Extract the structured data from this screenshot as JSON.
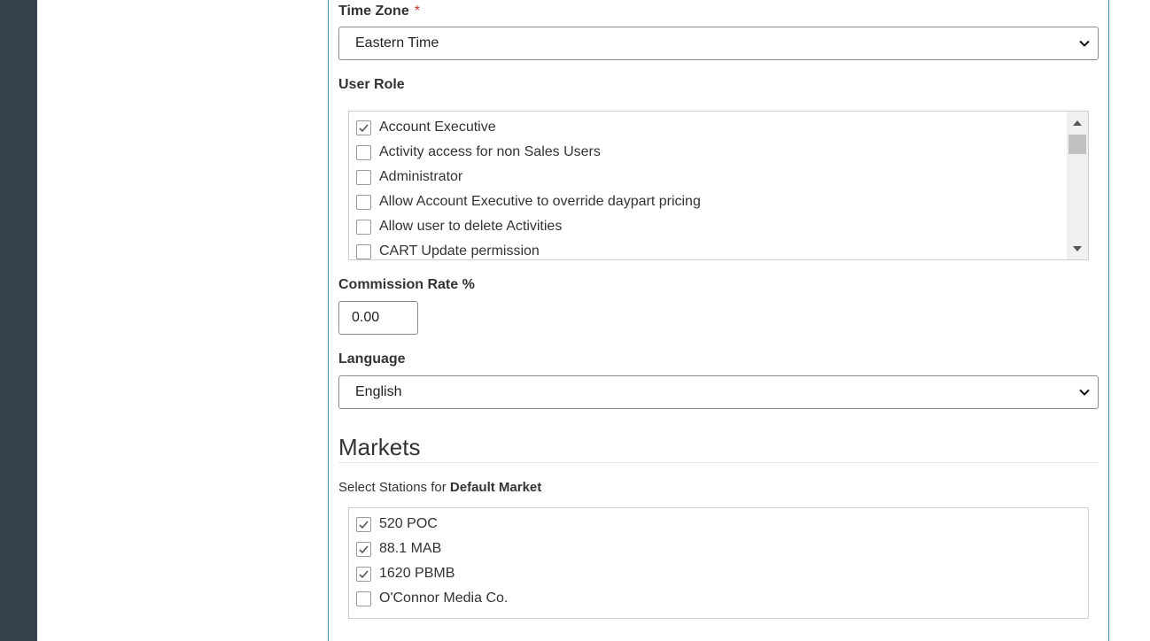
{
  "time_zone": {
    "label": "Time Zone",
    "required_marker": "*",
    "selected": "Eastern Time"
  },
  "user_role": {
    "label": "User Role",
    "items": [
      {
        "label": "Account Executive",
        "checked": true
      },
      {
        "label": "Activity access for non Sales Users",
        "checked": false
      },
      {
        "label": "Administrator",
        "checked": false
      },
      {
        "label": "Allow Account Executive to override daypart pricing",
        "checked": false
      },
      {
        "label": "Allow user to delete Activities",
        "checked": false
      },
      {
        "label": "CART Update permission",
        "checked": false
      }
    ]
  },
  "commission": {
    "label": "Commission Rate %",
    "value": "0.00"
  },
  "language": {
    "label": "Language",
    "selected": "English"
  },
  "markets": {
    "title": "Markets",
    "subtext_prefix": "Select Stations for",
    "subtext_bold": "Default Market",
    "stations": [
      {
        "label": "520 POC",
        "checked": true
      },
      {
        "label": "88.1 MAB",
        "checked": true
      },
      {
        "label": "1620 PBMB",
        "checked": true
      },
      {
        "label": "O'Connor Media Co.",
        "checked": false
      }
    ]
  },
  "icons": {
    "dropdown": "chevron-down-icon",
    "check": "check-icon",
    "scroll_up": "triangle-up-icon",
    "scroll_down": "triangle-down-icon"
  }
}
